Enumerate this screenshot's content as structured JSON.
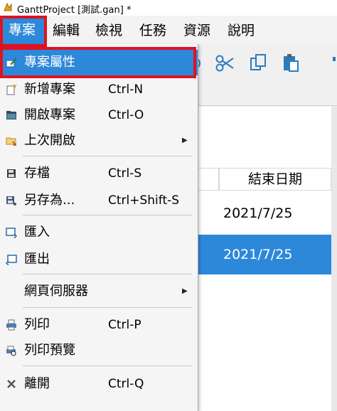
{
  "window": {
    "title": "GanttProject [測試.gan] *"
  },
  "menubar": {
    "items": [
      {
        "label": "專案"
      },
      {
        "label": "編輯"
      },
      {
        "label": "檢視"
      },
      {
        "label": "任務"
      },
      {
        "label": "資源"
      },
      {
        "label": "說明"
      }
    ]
  },
  "project_menu": {
    "items": [
      {
        "label": "專案屬性",
        "icon": "properties-icon"
      },
      {
        "label": "新增專案",
        "shortcut": "Ctrl-N",
        "icon": "new-project-icon"
      },
      {
        "label": "開啟專案",
        "shortcut": "Ctrl-O",
        "icon": "open-folder-icon"
      },
      {
        "label": "上次開啟",
        "icon": "recent-folder-icon"
      },
      {
        "label": "存檔",
        "shortcut": "Ctrl-S",
        "icon": "save-icon"
      },
      {
        "label": "另存為...",
        "shortcut": "Ctrl+Shift-S",
        "icon": "save-as-icon"
      },
      {
        "label": "匯入",
        "icon": "import-icon"
      },
      {
        "label": "匯出",
        "icon": "export-icon"
      },
      {
        "label": "網頁伺服器"
      },
      {
        "label": "列印",
        "shortcut": "Ctrl-P",
        "icon": "print-icon"
      },
      {
        "label": "列印預覽",
        "icon": "print-preview-icon"
      },
      {
        "label": "離開",
        "shortcut": "Ctrl-Q",
        "icon": "exit-icon"
      }
    ]
  },
  "table": {
    "column_header": "結束日期",
    "rows": [
      {
        "end_date": "2021/7/25"
      },
      {
        "end_date": "2021/7/25"
      }
    ]
  },
  "colors": {
    "accent": "#2d88d9",
    "highlight_box": "#e0121f"
  }
}
